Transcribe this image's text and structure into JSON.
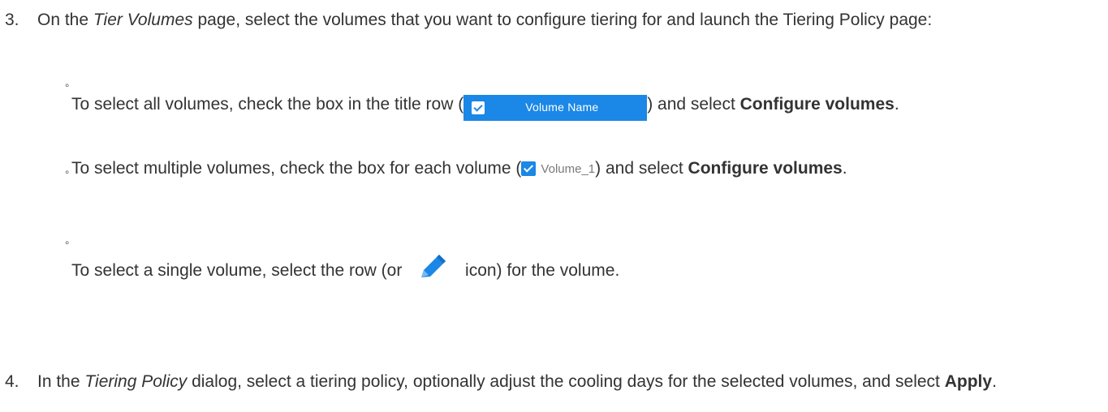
{
  "step3": {
    "number": "3.",
    "text_before": "On the ",
    "page_name": "Tier Volumes",
    "text_after": " page, select the volumes that you want to configure tiering for and launch the Tiering Policy page:",
    "bullet_glyph": "◦",
    "items": [
      {
        "text_before": "To select all volumes, check the box in the title row (",
        "chip_label": "Volume Name",
        "text_after": ") and select ",
        "bold": "Configure volumes",
        "end": "."
      },
      {
        "text_before": "To select multiple volumes, check the box for each volume (",
        "chip_label": "Volume_1",
        "text_after": ") and select ",
        "bold": "Configure volumes",
        "end": "."
      },
      {
        "text_before": "To select a single volume, select the row (or ",
        "icon": "pencil-edit-icon",
        "text_after": " icon) for the volume."
      }
    ]
  },
  "step4": {
    "number": "4.",
    "text_before": "In the ",
    "dialog_name": "Tiering Policy",
    "text_middle": " dialog, select a tiering policy, optionally adjust the cooling days for the selected volumes, and select ",
    "bold": "Apply",
    "end": "."
  },
  "colors": {
    "text": "#333333",
    "accent_blue": "#1b87e6",
    "chip_muted_text": "#7a7a7a"
  }
}
